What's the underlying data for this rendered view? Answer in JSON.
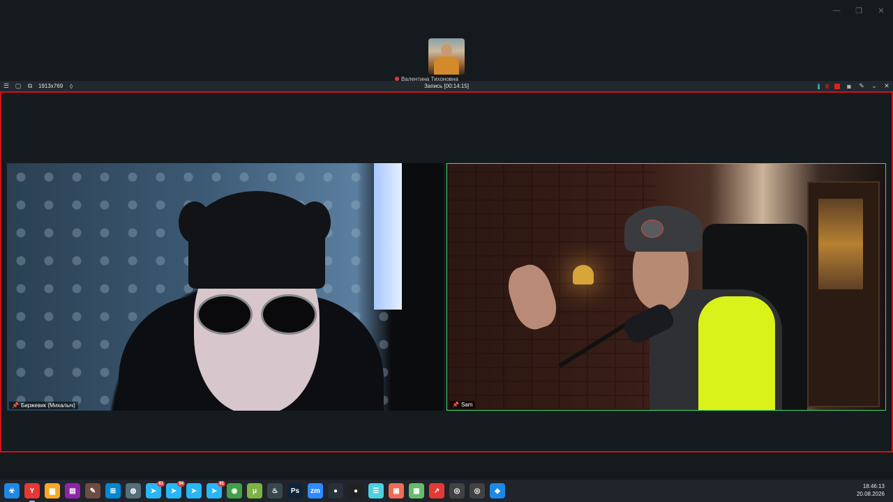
{
  "window": {
    "minimize_glyph": "—",
    "maximize_glyph": "❐",
    "close_glyph": "✕"
  },
  "thumbnail": {
    "name": "Валентина Тихоновна"
  },
  "recorder": {
    "size_label": "1913x769",
    "title": "Запись [00:14:15]",
    "pause_glyph": "II"
  },
  "participants": [
    {
      "name": "Биржевик (Михалыч)"
    },
    {
      "name": "Sam"
    }
  ],
  "taskbar": {
    "icons": [
      {
        "name": "biohazard-icon",
        "glyph": "☣",
        "color": "#1e88e5",
        "badge": ""
      },
      {
        "name": "yandex-browser-icon",
        "glyph": "Y",
        "color": "#e53935",
        "badge": ""
      },
      {
        "name": "file-explorer-icon",
        "glyph": "▆",
        "color": "#f9a825",
        "badge": ""
      },
      {
        "name": "winrar-icon",
        "glyph": "▤",
        "color": "#8e24aa",
        "badge": ""
      },
      {
        "name": "sticky-tool-icon",
        "glyph": "✎",
        "color": "#6d4c41",
        "badge": ""
      },
      {
        "name": "windows-app-icon",
        "glyph": "⊞",
        "color": "#0288d1",
        "badge": ""
      },
      {
        "name": "globe-icon",
        "glyph": "◍",
        "color": "#546e7a",
        "badge": ""
      },
      {
        "name": "telegram-icon-1",
        "glyph": "➤",
        "color": "#29b6f6",
        "badge": "61"
      },
      {
        "name": "telegram-icon-2",
        "glyph": "➤",
        "color": "#29b6f6",
        "badge": "94"
      },
      {
        "name": "telegram-icon-3",
        "glyph": "➤",
        "color": "#29b6f6",
        "badge": ""
      },
      {
        "name": "telegram-icon-4",
        "glyph": "➤",
        "color": "#29b6f6",
        "badge": "91"
      },
      {
        "name": "chrome-icon",
        "glyph": "◉",
        "color": "#43a047",
        "badge": ""
      },
      {
        "name": "utorrent-icon",
        "glyph": "μ",
        "color": "#7cb342",
        "badge": ""
      },
      {
        "name": "steam-icon",
        "glyph": "♨",
        "color": "#37474f",
        "badge": ""
      },
      {
        "name": "photoshop-icon",
        "glyph": "Ps",
        "color": "#0d2538",
        "badge": ""
      },
      {
        "name": "zoom-icon",
        "glyph": "zm",
        "color": "#2d8cff",
        "badge": ""
      },
      {
        "name": "obs-icon",
        "glyph": "●",
        "color": "#263238",
        "badge": ""
      },
      {
        "name": "record-icon",
        "glyph": "●",
        "color": "#212121",
        "badge": ""
      },
      {
        "name": "notes-icon",
        "glyph": "☰",
        "color": "#4dd0e1",
        "badge": ""
      },
      {
        "name": "slides-icon",
        "glyph": "▣",
        "color": "#ef6c57",
        "badge": ""
      },
      {
        "name": "sheets-icon",
        "glyph": "▦",
        "color": "#66bb6a",
        "badge": ""
      },
      {
        "name": "arrow-app-icon",
        "glyph": "↗",
        "color": "#e53935",
        "badge": ""
      },
      {
        "name": "obs-studio-icon",
        "glyph": "◎",
        "color": "#424242",
        "badge": ""
      },
      {
        "name": "obs-studio-icon-2",
        "glyph": "◎",
        "color": "#424242",
        "badge": ""
      },
      {
        "name": "paint-icon",
        "glyph": "◆",
        "color": "#1e88e5",
        "badge": ""
      }
    ],
    "time": "18:46:13",
    "date": "20.08.2026"
  }
}
